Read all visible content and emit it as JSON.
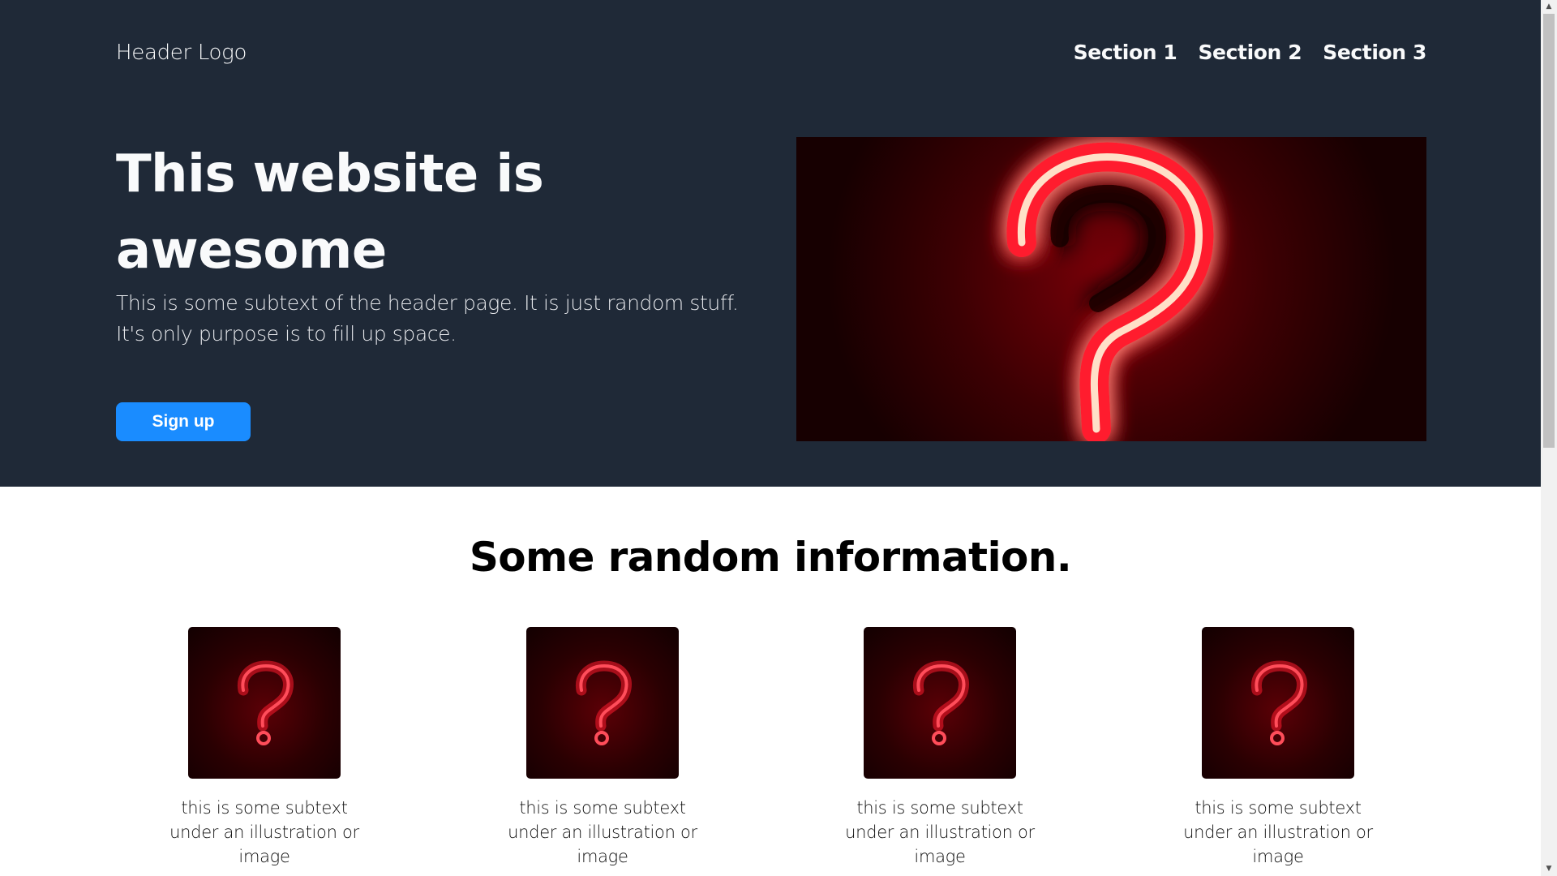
{
  "header": {
    "logo": "Header Logo",
    "nav": [
      "Section 1",
      "Section 2",
      "Section 3"
    ]
  },
  "hero": {
    "title": "This website is awesome",
    "subtext": "This is some subtext of the header page. It is just random stuff. It's only purpose is to fill up space.",
    "cta_label": "Sign up",
    "image_icon": "question-mark-neon"
  },
  "info": {
    "title": "Some random information.",
    "cards": [
      {
        "text": "this is some subtext under an illustration or image",
        "icon": "question-mark-neon"
      },
      {
        "text": "this is some subtext under an illustration or image",
        "icon": "question-mark-neon"
      },
      {
        "text": "this is some subtext under an illustration or image",
        "icon": "question-mark-neon"
      },
      {
        "text": "this is some subtext under an illustration or image",
        "icon": "question-mark-neon"
      }
    ]
  },
  "colors": {
    "hero_background": "#1f2937",
    "cta_background": "#1a8cff",
    "neon_red": "#ff1a2e"
  }
}
